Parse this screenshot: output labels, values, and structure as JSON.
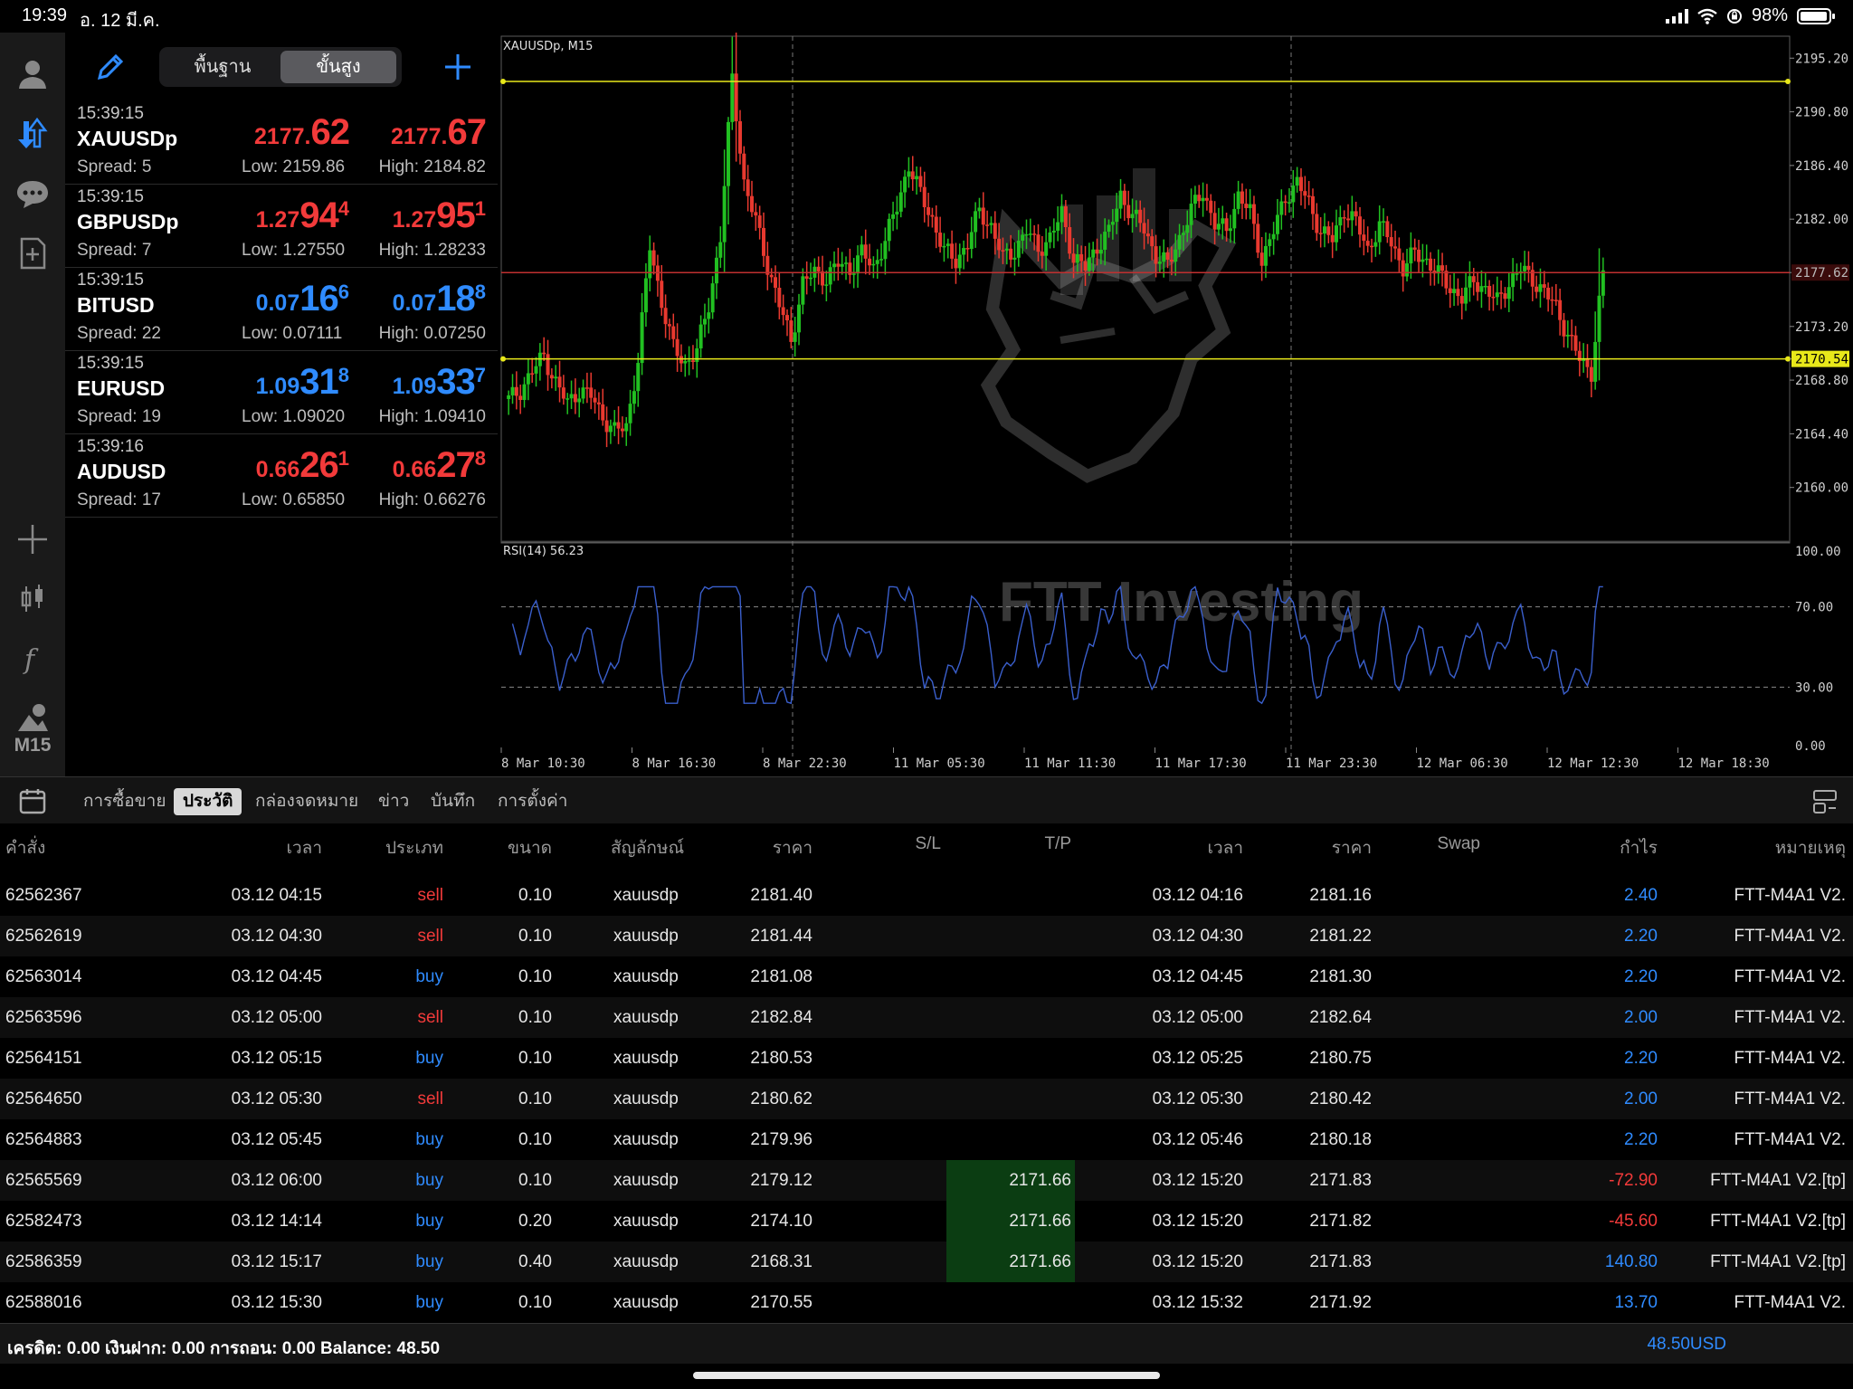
{
  "status_bar": {
    "time": "19:39",
    "date": "อ. 12 มี.ค.",
    "battery": "98%",
    "battery_level": 0.98
  },
  "left_rail": {
    "icons": [
      "profile-icon",
      "trade-arrows-icon",
      "chat-icon",
      "new-document-icon",
      "crosshair-icon",
      "candlestick-icon",
      "function-icon",
      "objects-icon"
    ],
    "timeframe": "M15"
  },
  "quotes_panel": {
    "segment": {
      "basic": "พื้นฐาน",
      "advanced": "ขั้นสูง",
      "active": "advanced"
    },
    "items": [
      {
        "time": "15:39:15",
        "symbol": "XAUUSDp",
        "spread": "Spread: 5",
        "low": "Low: 2159.86",
        "high": "High: 2184.82",
        "bid": {
          "small": "2177.",
          "big": "62",
          "sup": ""
        },
        "ask": {
          "small": "2177.",
          "big": "67",
          "sup": ""
        },
        "color": "red"
      },
      {
        "time": "15:39:15",
        "symbol": "GBPUSDp",
        "spread": "Spread: 7",
        "low": "Low: 1.27550",
        "high": "High: 1.28233",
        "bid": {
          "small": "1.27",
          "big": "94",
          "sup": "4"
        },
        "ask": {
          "small": "1.27",
          "big": "95",
          "sup": "1"
        },
        "color": "red"
      },
      {
        "time": "15:39:15",
        "symbol": "BITUSD",
        "spread": "Spread: 22",
        "low": "Low: 0.07111",
        "high": "High: 0.07250",
        "bid": {
          "small": "0.07",
          "big": "16",
          "sup": "6"
        },
        "ask": {
          "small": "0.07",
          "big": "18",
          "sup": "8"
        },
        "color": "blue"
      },
      {
        "time": "15:39:15",
        "symbol": "EURUSD",
        "spread": "Spread: 19",
        "low": "Low: 1.09020",
        "high": "High: 1.09410",
        "bid": {
          "small": "1.09",
          "big": "31",
          "sup": "8"
        },
        "ask": {
          "small": "1.09",
          "big": "33",
          "sup": "7"
        },
        "color": "blue"
      },
      {
        "time": "15:39:16",
        "symbol": "AUDUSD",
        "spread": "Spread: 17",
        "low": "Low: 0.65850",
        "high": "High: 0.66276",
        "bid": {
          "small": "0.66",
          "big": "26",
          "sup": "1"
        },
        "ask": {
          "small": "0.66",
          "big": "27",
          "sup": "8"
        },
        "color": "red"
      }
    ]
  },
  "chart": {
    "symbol_label": "XAUUSDp, M15",
    "price_ticks": [
      "2195.20",
      "2190.80",
      "2186.40",
      "2182.00",
      "2177.62",
      "2173.20",
      "2170.54",
      "2168.80",
      "2164.40",
      "2160.00"
    ],
    "price_range": [
      2155.6,
      2197.0
    ],
    "levels": [
      {
        "label": "2193.29",
        "price": 2193.29,
        "color": "#e8e81a"
      },
      {
        "label": "2177.62",
        "price": 2177.62,
        "color": "#c03030"
      },
      {
        "label": "2170.54",
        "price": 2170.54,
        "color": "#e8e81a"
      }
    ],
    "rsi_label": "RSI(14) 56.23",
    "rsi_ticks": [
      "100.00",
      "70.00",
      "30.00",
      "0.00"
    ],
    "time_ticks": [
      "8 Mar 10:30",
      "8 Mar 16:30",
      "8 Mar 22:30",
      "11 Mar 05:30",
      "11 Mar 11:30",
      "11 Mar 17:30",
      "11 Mar 23:30",
      "12 Mar 06:30",
      "12 Mar 12:30",
      "12 Mar 18:30"
    ],
    "watermark": "FTT Investing",
    "colors": {
      "up": "#21c021",
      "down": "#e8392f",
      "rsi": "#3a5fcd"
    },
    "candle_path": [
      2167.2,
      2168.0,
      2169.5,
      2170.8,
      2168.6,
      2166.9,
      2168.0,
      2167.5,
      2165.8,
      2164.6,
      2165.0,
      2170.5,
      2179.8,
      2175.2,
      2171.4,
      2170.2,
      2171.2,
      2175.0,
      2180.5,
      2193.5,
      2185.0,
      2181.8,
      2178.2,
      2175.0,
      2172.0,
      2176.8,
      2177.6,
      2177.2,
      2178.3,
      2177.9,
      2179.2,
      2178.0,
      2180.3,
      2183.0,
      2186.5,
      2184.0,
      2182.0,
      2179.4,
      2178.6,
      2180.0,
      2182.7,
      2181.4,
      2178.8,
      2179.5,
      2181.0,
      2179.6,
      2180.4,
      2182.5,
      2178.8,
      2178.0,
      2179.8,
      2180.9,
      2184.0,
      2182.3,
      2181.2,
      2179.0,
      2178.2,
      2180.5,
      2182.7,
      2184.3,
      2181.6,
      2181.0,
      2184.0,
      2182.5,
      2178.7,
      2181.0,
      2183.8,
      2185.0,
      2183.3,
      2181.0,
      2180.3,
      2182.8,
      2181.7,
      2179.5,
      2181.5,
      2180.1,
      2178.0,
      2179.2,
      2178.6,
      2177.5,
      2176.4,
      2175.5,
      2177.0,
      2176.3,
      2175.2,
      2176.8,
      2177.9,
      2177.1,
      2176.0,
      2174.8,
      2172.5,
      2170.5,
      2169.5,
      2177.8
    ]
  },
  "tabs": {
    "items": [
      "การซื้อขาย",
      "ประวัติ",
      "กล่องจดหมาย",
      "ข่าว",
      "บันทึก",
      "การตั้งค่า"
    ],
    "active": 1
  },
  "history_table": {
    "headers": {
      "order": "คำสั่ง",
      "time": "เวลา",
      "type": "ประเภท",
      "volume": "ขนาด",
      "symbol": "สัญลักษณ์",
      "price": "ราคา",
      "sl": "S/L",
      "tp": "T/P",
      "close_time": "เวลา",
      "close_price": "ราคา",
      "swap": "Swap",
      "profit": "กำไร",
      "comment": "หมายเหตุ"
    },
    "rows": [
      {
        "order": "62562367",
        "time": "03.12 04:15",
        "type": "sell",
        "volume": "0.10",
        "symbol": "xauusdp",
        "price": "2181.40",
        "tp": "",
        "close_time": "03.12 04:16",
        "close_price": "2181.16",
        "profit": "2.40",
        "comment": "FTT-M4A1 V2."
      },
      {
        "order": "62562619",
        "time": "03.12 04:30",
        "type": "sell",
        "volume": "0.10",
        "symbol": "xauusdp",
        "price": "2181.44",
        "tp": "",
        "close_time": "03.12 04:30",
        "close_price": "2181.22",
        "profit": "2.20",
        "comment": "FTT-M4A1 V2."
      },
      {
        "order": "62563014",
        "time": "03.12 04:45",
        "type": "buy",
        "volume": "0.10",
        "symbol": "xauusdp",
        "price": "2181.08",
        "tp": "",
        "close_time": "03.12 04:45",
        "close_price": "2181.30",
        "profit": "2.20",
        "comment": "FTT-M4A1 V2."
      },
      {
        "order": "62563596",
        "time": "03.12 05:00",
        "type": "sell",
        "volume": "0.10",
        "symbol": "xauusdp",
        "price": "2182.84",
        "tp": "",
        "close_time": "03.12 05:00",
        "close_price": "2182.64",
        "profit": "2.00",
        "comment": "FTT-M4A1 V2."
      },
      {
        "order": "62564151",
        "time": "03.12 05:15",
        "type": "buy",
        "volume": "0.10",
        "symbol": "xauusdp",
        "price": "2180.53",
        "tp": "",
        "close_time": "03.12 05:25",
        "close_price": "2180.75",
        "profit": "2.20",
        "comment": "FTT-M4A1 V2."
      },
      {
        "order": "62564650",
        "time": "03.12 05:30",
        "type": "sell",
        "volume": "0.10",
        "symbol": "xauusdp",
        "price": "2180.62",
        "tp": "",
        "close_time": "03.12 05:30",
        "close_price": "2180.42",
        "profit": "2.00",
        "comment": "FTT-M4A1 V2."
      },
      {
        "order": "62564883",
        "time": "03.12 05:45",
        "type": "buy",
        "volume": "0.10",
        "symbol": "xauusdp",
        "price": "2179.96",
        "tp": "",
        "close_time": "03.12 05:46",
        "close_price": "2180.18",
        "profit": "2.20",
        "comment": "FTT-M4A1 V2."
      },
      {
        "order": "62565569",
        "time": "03.12 06:00",
        "type": "buy",
        "volume": "0.10",
        "symbol": "xauusdp",
        "price": "2179.12",
        "tp": "2171.66",
        "close_time": "03.12 15:20",
        "close_price": "2171.83",
        "profit": "-72.90",
        "comment": "FTT-M4A1 V2.[tp]"
      },
      {
        "order": "62582473",
        "time": "03.12 14:14",
        "type": "buy",
        "volume": "0.20",
        "symbol": "xauusdp",
        "price": "2174.10",
        "tp": "2171.66",
        "close_time": "03.12 15:20",
        "close_price": "2171.82",
        "profit": "-45.60",
        "comment": "FTT-M4A1 V2.[tp]"
      },
      {
        "order": "62586359",
        "time": "03.12 15:17",
        "type": "buy",
        "volume": "0.40",
        "symbol": "xauusdp",
        "price": "2168.31",
        "tp": "2171.66",
        "close_time": "03.12 15:20",
        "close_price": "2171.83",
        "profit": "140.80",
        "comment": "FTT-M4A1 V2.[tp]"
      },
      {
        "order": "62588016",
        "time": "03.12 15:30",
        "type": "buy",
        "volume": "0.10",
        "symbol": "xauusdp",
        "price": "2170.55",
        "tp": "",
        "close_time": "03.12 15:32",
        "close_price": "2171.92",
        "profit": "13.70",
        "comment": "FTT-M4A1 V2."
      }
    ]
  },
  "footer": {
    "summary": "เครดิต: 0.00 เงินฝาก: 0.00 การถอน: 0.00 Balance: 48.50",
    "balance": "48.50",
    "currency": "USD"
  }
}
